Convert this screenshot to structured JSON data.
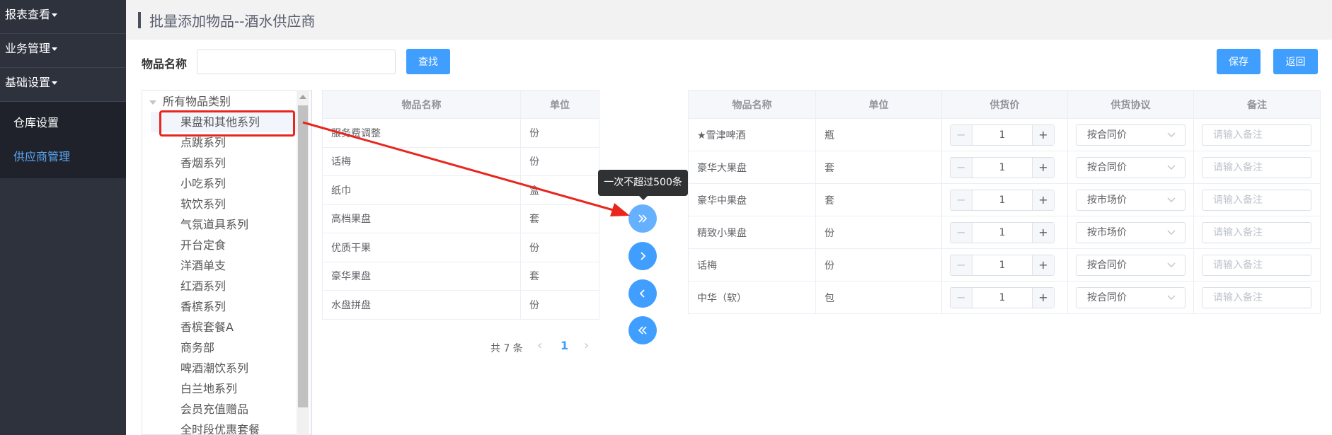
{
  "sidebar": {
    "menus": [
      {
        "label": "报表查看"
      },
      {
        "label": "业务管理"
      },
      {
        "label": "基础设置"
      }
    ],
    "sub_items": [
      {
        "label": "仓库设置",
        "active": false
      },
      {
        "label": "供应商管理",
        "active": true
      }
    ]
  },
  "page": {
    "title": "批量添加物品--酒水供应商"
  },
  "toolbar": {
    "name_label": "物品名称",
    "search_value": "",
    "search_label": "查找",
    "save_label": "保存",
    "back_label": "返回"
  },
  "tree": {
    "root": "所有物品类别",
    "children": [
      "果盘和其他系列",
      "点跳系列",
      "香烟系列",
      "小吃系列",
      "软饮系列",
      "气氛道具系列",
      "开台定食",
      "洋酒单支",
      "红酒系列",
      "香槟系列",
      "香槟套餐A",
      "商务部",
      "啤酒潮饮系列",
      "白兰地系列",
      "会员充值赠品",
      "全时段优惠套餐"
    ],
    "selected": "果盘和其他系列"
  },
  "source_table": {
    "headers": [
      "物品名称",
      "单位"
    ],
    "rows": [
      [
        "服务费调整",
        "份"
      ],
      [
        "话梅",
        "份"
      ],
      [
        "纸巾",
        "盒"
      ],
      [
        "高档果盘",
        "套"
      ],
      [
        "优质干果",
        "份"
      ],
      [
        "豪华果盘",
        "套"
      ],
      [
        "水盘拼盘",
        "份"
      ]
    ]
  },
  "pagination": {
    "total_text": "共 7 条",
    "current_page": "1",
    "prev": "‹",
    "next": "›"
  },
  "tooltip": {
    "text": "一次不超过500条"
  },
  "transfer": {
    "icons": [
      "double-chevron-right-icon",
      "chevron-right-icon",
      "chevron-left-icon",
      "double-chevron-left-icon"
    ]
  },
  "target_table": {
    "headers": [
      "物品名称",
      "单位",
      "供货价",
      "供货协议",
      "备注"
    ],
    "remark_placeholder": "请输入备注",
    "stepper_minus": "−",
    "stepper_plus": "+",
    "rows": [
      {
        "name": "★雪津啤酒",
        "unit": "瓶",
        "price": "1",
        "agreement": "按合同价"
      },
      {
        "name": "豪华大果盘",
        "unit": "套",
        "price": "1",
        "agreement": "按合同价"
      },
      {
        "name": "豪华中果盘",
        "unit": "套",
        "price": "1",
        "agreement": "按市场价"
      },
      {
        "name": "精致小果盘",
        "unit": "份",
        "price": "1",
        "agreement": "按市场价"
      },
      {
        "name": "话梅",
        "unit": "份",
        "price": "1",
        "agreement": "按合同价"
      },
      {
        "name": "中华（软）",
        "unit": "包",
        "price": "1",
        "agreement": "按合同价"
      }
    ]
  },
  "colors": {
    "accent": "#409eff",
    "sidebar_bg": "#2e323d",
    "annotation_red": "#e8261e"
  }
}
